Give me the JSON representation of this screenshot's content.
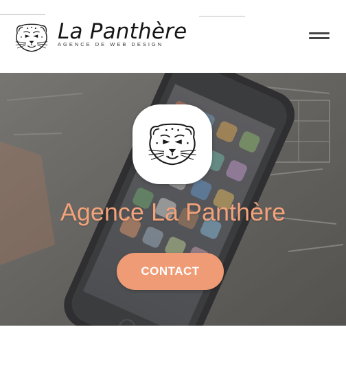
{
  "header": {
    "brand_name": "La Panthère",
    "brand_tagline": "AGENCE DE WEB DESIGN",
    "logo_icon": "panther-head-icon",
    "menu_icon": "hamburger-menu-icon"
  },
  "hero": {
    "badge_icon": "panther-head-icon",
    "title": "Agence La Panthère",
    "cta_label": "CONTACT",
    "background": "smartphone-on-sketches-photo"
  },
  "colors": {
    "accent": "#ef9b75",
    "title": "#f2a27a",
    "text_dark": "#151515",
    "background": "#ffffff"
  }
}
